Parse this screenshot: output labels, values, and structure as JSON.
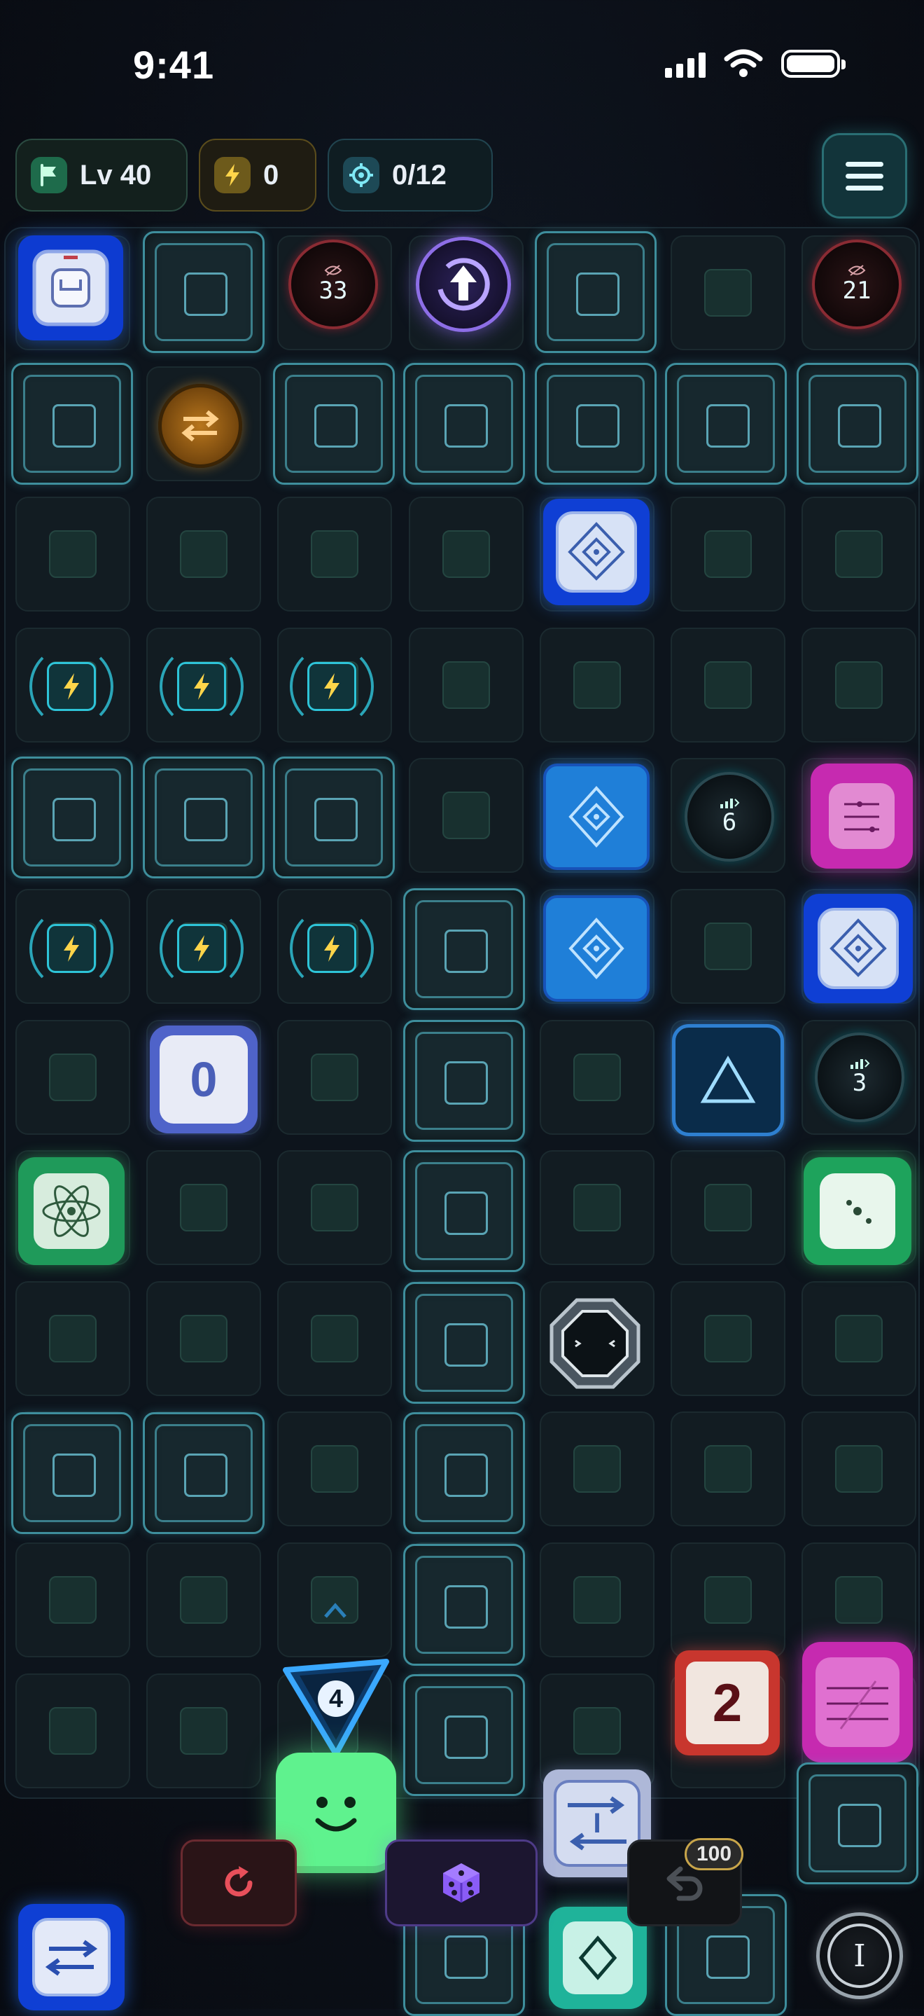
{
  "status_bar": {
    "time": "9:41"
  },
  "hud": {
    "level": "Lv 40",
    "energy": "0",
    "targets": "0/12"
  },
  "board": {
    "columns": 7,
    "rows": 12,
    "dials": {
      "dial_a": "33",
      "dial_b": "21",
      "dial_c": "6",
      "dial_d": "3"
    },
    "counter_tile": "0",
    "player_marker": "4",
    "number_tile": "2",
    "gate_tile": "I",
    "round_gate": "I"
  },
  "bottom": {
    "undo_badge": "100"
  },
  "colors": {
    "accent": "#2ec4d8",
    "restart": "#e8505b",
    "dice": "#8a5cf6",
    "player": "#5ff28e"
  }
}
